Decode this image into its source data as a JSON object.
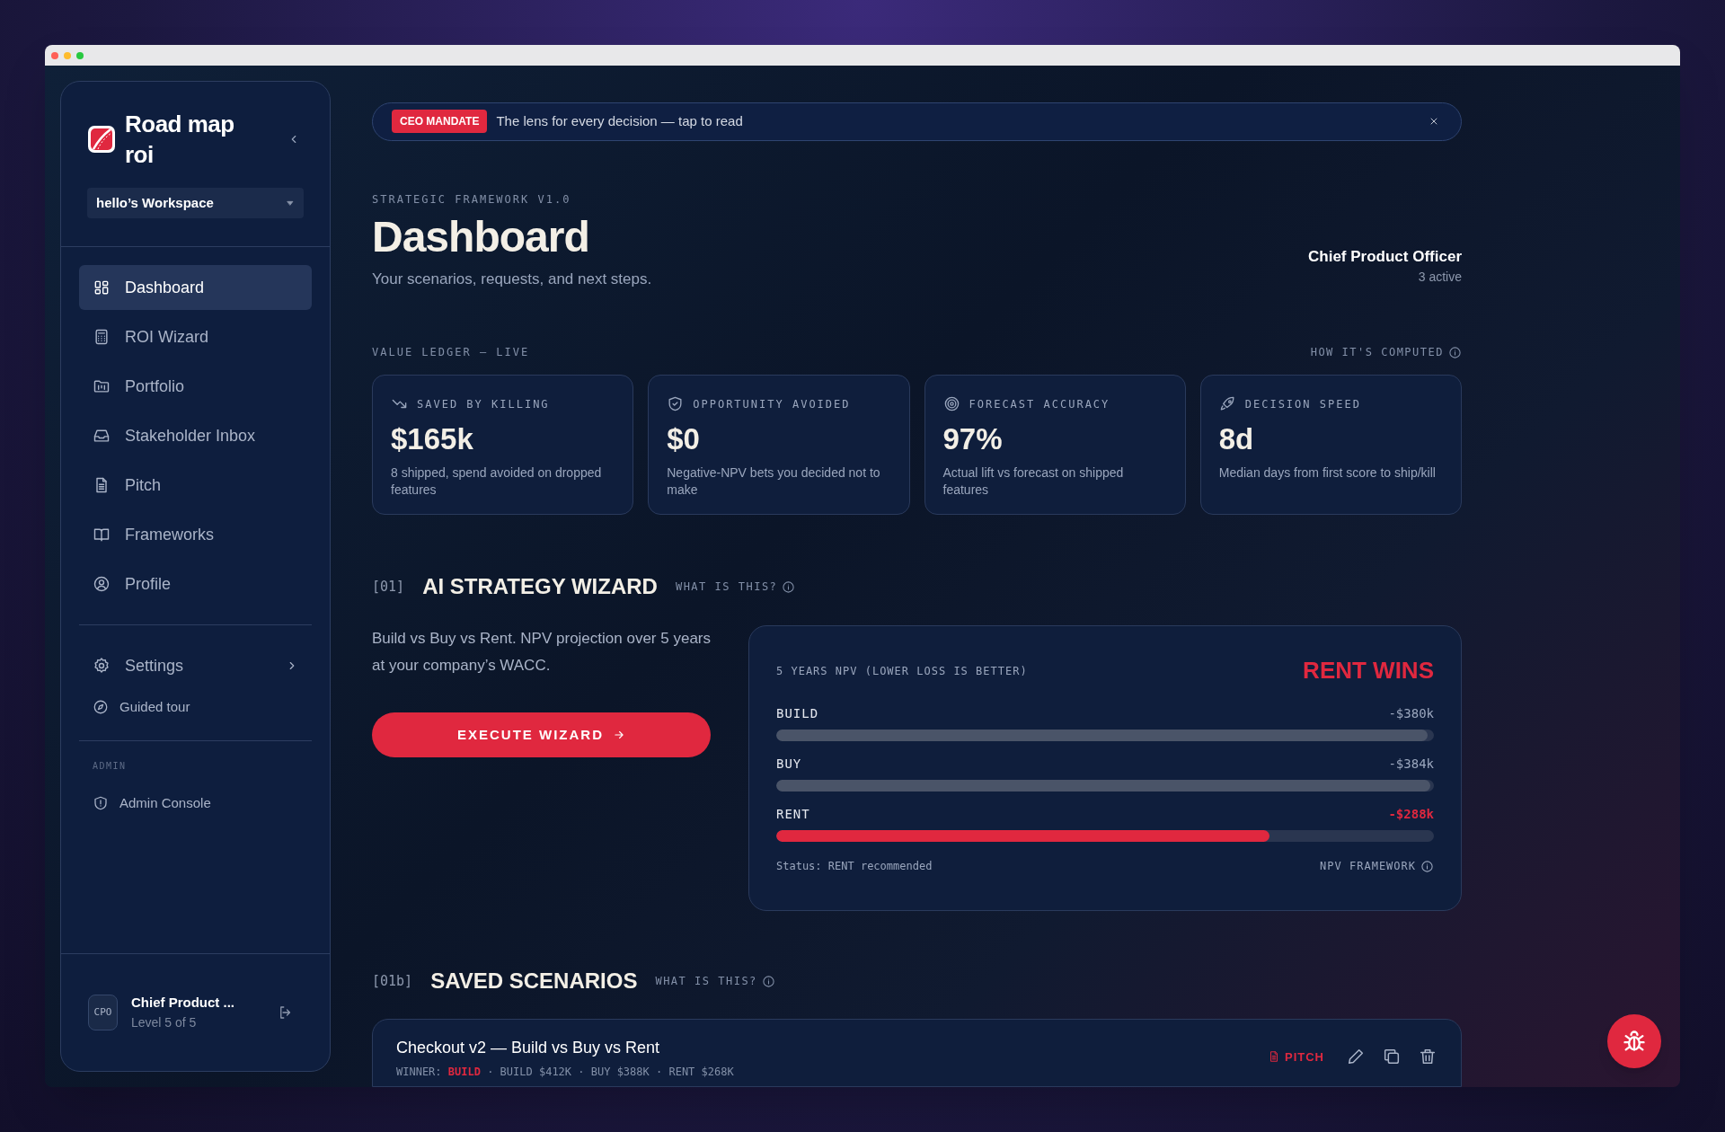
{
  "app": {
    "name": "Road map roi",
    "workspace": "hello’s Workspace"
  },
  "nav": [
    {
      "label": "Dashboard",
      "selected": true
    },
    {
      "label": "ROI Wizard",
      "selected": false
    },
    {
      "label": "Portfolio",
      "selected": false
    },
    {
      "label": "Stakeholder Inbox",
      "selected": false
    },
    {
      "label": "Pitch",
      "selected": false
    },
    {
      "label": "Frameworks",
      "selected": false
    },
    {
      "label": "Profile",
      "selected": false
    }
  ],
  "settings": {
    "label": "Settings"
  },
  "tour": {
    "label": "Guided tour"
  },
  "admin": {
    "heading": "ADMIN",
    "items": [
      {
        "label": "Admin Console"
      }
    ]
  },
  "user": {
    "initials": "CPO",
    "name": "Chief Product ...",
    "level": "Level 5 of 5"
  },
  "banner": {
    "badge": "CEO MANDATE",
    "text": "The lens for every decision — tap to read"
  },
  "header": {
    "eyebrow": "STRATEGIC FRAMEWORK V1.0",
    "title": "Dashboard",
    "subtitle": "Your scenarios, requests, and next steps.",
    "role": "Chief Product Officer",
    "role_note": "3 active"
  },
  "ledger": {
    "title": "VALUE LEDGER — LIVE",
    "link": "HOW IT'S COMPUTED",
    "cards": [
      {
        "label": "SAVED BY KILLING",
        "value": "$165k",
        "note": "8 shipped, spend avoided on dropped features"
      },
      {
        "label": "OPPORTUNITY AVOIDED",
        "value": "$0",
        "note": "Negative-NPV bets you decided not to make"
      },
      {
        "label": "FORECAST ACCURACY",
        "value": "97%",
        "note": "Actual lift vs forecast on shipped features"
      },
      {
        "label": "DECISION SPEED",
        "value": "8d",
        "note": "Median days from first score to ship/kill"
      }
    ]
  },
  "wizard": {
    "index": "[01]",
    "title": "AI STRATEGY WIZARD",
    "help": "WHAT IS THIS?",
    "description": "Build vs Buy vs Rent. NPV projection over 5 years at your company’s WACC.",
    "button": "EXECUTE WIZARD",
    "panel": {
      "caption": "5 YEARS NPV (LOWER LOSS IS BETTER)",
      "verdict": "RENT WINS",
      "options": [
        {
          "name": "BUILD",
          "reading": "-$380k",
          "level": 0.99,
          "winner": false
        },
        {
          "name": "BUY",
          "reading": "-$384k",
          "level": 0.995,
          "winner": false
        },
        {
          "name": "RENT",
          "reading": "-$288k",
          "level": 0.75,
          "winner": true
        }
      ],
      "status": "Status: RENT recommended",
      "link": "NPV FRAMEWORK"
    }
  },
  "saved": {
    "index": "[01b]",
    "title": "SAVED SCENARIOS",
    "help": "WHAT IS THIS?",
    "scenarios": [
      {
        "title": "Checkout v2 — Build vs Buy vs Rent",
        "winner_label": "WINNER:",
        "winner": "BUILD",
        "details": "· BUILD $412K · BUY $388K · RENT $268K",
        "action": "PITCH"
      }
    ]
  }
}
